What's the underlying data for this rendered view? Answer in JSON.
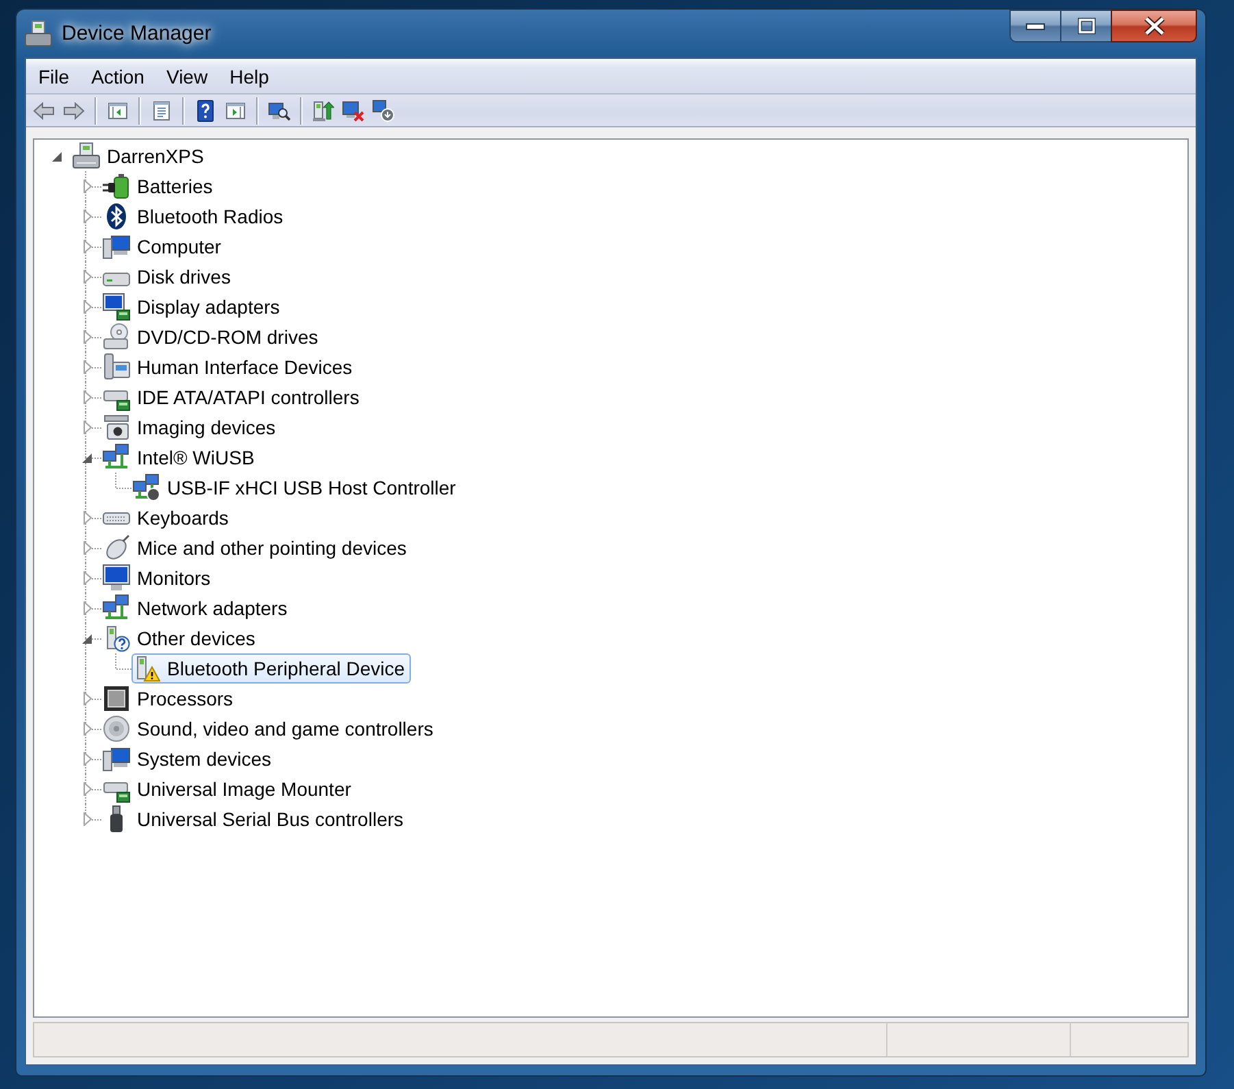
{
  "window": {
    "title": "Device Manager"
  },
  "menu": [
    "File",
    "Action",
    "View",
    "Help"
  ],
  "toolbar": [
    {
      "kind": "back"
    },
    {
      "kind": "forward"
    },
    {
      "kind": "separator"
    },
    {
      "kind": "console-tree"
    },
    {
      "kind": "separator"
    },
    {
      "kind": "properties"
    },
    {
      "kind": "separator"
    },
    {
      "kind": "help"
    },
    {
      "kind": "action-pane"
    },
    {
      "kind": "separator"
    },
    {
      "kind": "scan"
    },
    {
      "kind": "separator"
    },
    {
      "kind": "update"
    },
    {
      "kind": "uninstall"
    },
    {
      "kind": "disable"
    }
  ],
  "tree": {
    "label": "DarrenXPS",
    "kind": "host",
    "expanded": true,
    "selected": false,
    "children": [
      {
        "label": "Batteries",
        "kind": "battery",
        "expanded": false,
        "selected": false
      },
      {
        "label": "Bluetooth Radios",
        "kind": "bluetooth",
        "expanded": false,
        "selected": false
      },
      {
        "label": "Computer",
        "kind": "computer",
        "expanded": false,
        "selected": false
      },
      {
        "label": "Disk drives",
        "kind": "disk",
        "expanded": false,
        "selected": false
      },
      {
        "label": "Display adapters",
        "kind": "display",
        "expanded": false,
        "selected": false
      },
      {
        "label": "DVD/CD-ROM drives",
        "kind": "dvd",
        "expanded": false,
        "selected": false
      },
      {
        "label": "Human Interface Devices",
        "kind": "hid",
        "expanded": false,
        "selected": false
      },
      {
        "label": "IDE ATA/ATAPI controllers",
        "kind": "ide",
        "expanded": false,
        "selected": false
      },
      {
        "label": "Imaging devices",
        "kind": "imaging",
        "expanded": false,
        "selected": false
      },
      {
        "label": "Intel® WiUSB",
        "kind": "network",
        "expanded": true,
        "selected": false,
        "children": [
          {
            "label": "USB-IF xHCI USB Host Controller",
            "kind": "usb-host",
            "selected": false
          }
        ]
      },
      {
        "label": "Keyboards",
        "kind": "keyboard",
        "expanded": false,
        "selected": false
      },
      {
        "label": "Mice and other pointing devices",
        "kind": "mouse",
        "expanded": false,
        "selected": false
      },
      {
        "label": "Monitors",
        "kind": "monitor",
        "expanded": false,
        "selected": false
      },
      {
        "label": "Network adapters",
        "kind": "network",
        "expanded": false,
        "selected": false
      },
      {
        "label": "Other devices",
        "kind": "unknown",
        "expanded": true,
        "selected": false,
        "children": [
          {
            "label": "Bluetooth Peripheral Device",
            "kind": "warning",
            "selected": true
          }
        ]
      },
      {
        "label": "Processors",
        "kind": "processor",
        "expanded": false,
        "selected": false
      },
      {
        "label": "Sound, video and game controllers",
        "kind": "sound",
        "expanded": false,
        "selected": false
      },
      {
        "label": "System devices",
        "kind": "computer",
        "expanded": false,
        "selected": false
      },
      {
        "label": "Universal Image Mounter",
        "kind": "ide",
        "expanded": false,
        "selected": false
      },
      {
        "label": "Universal Serial Bus controllers",
        "kind": "usb",
        "expanded": false,
        "selected": false
      }
    ]
  }
}
